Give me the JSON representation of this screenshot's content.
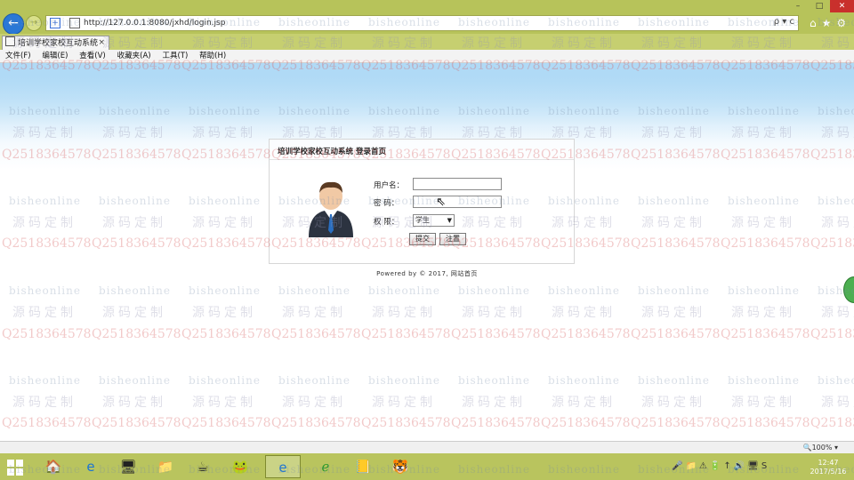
{
  "browser": {
    "url": "http://127.0.0.1:8080/jxhd/login.jsp",
    "tab_title": "培训学校家校互动系统",
    "tab_close": "×",
    "compat_icon": "compatibility-view-icon",
    "search_refresh": "ρ ▾ c",
    "window_controls": {
      "minimize": "–",
      "maximize": "□",
      "close": "✕"
    },
    "right_icons": "⌂★⚙"
  },
  "menu": [
    "文件(F)",
    "编辑(E)",
    "查看(V)",
    "收藏夹(A)",
    "工具(T)",
    "帮助(H)"
  ],
  "login": {
    "title": "培训学校家校互动系统 登录首页",
    "username_label": "用户名：",
    "password_label": "密  码：",
    "role_label": "权  限：",
    "username_value": "",
    "password_value": "",
    "role_selected": "学生",
    "submit_label": "提交",
    "reset_label": "注置"
  },
  "footer": "Powered by © 2017, 网站首页",
  "status": {
    "zoom": "🔍100%  ▾"
  },
  "taskbar": {
    "apps": [
      "🏠",
      "e",
      "🖥",
      "📁",
      "☕",
      "🐸",
      "e",
      "ℯ",
      "📒",
      "🐯"
    ],
    "tray": "🎤📁⚠🔋↑🔊🖥S",
    "time": "12:47",
    "date": "2017/5/16"
  },
  "watermark": {
    "en": "bisheonline",
    "cn": "源码定制",
    "q": "Q2518364578"
  }
}
